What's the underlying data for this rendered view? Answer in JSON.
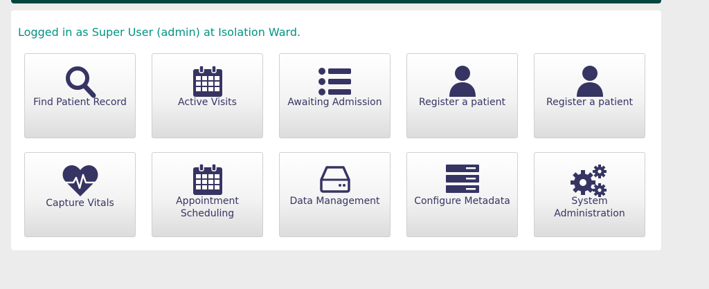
{
  "header": {
    "welcome": "Logged in as Super User (admin) at Isolation Ward."
  },
  "apps": [
    {
      "label": "Find Patient Record",
      "icon": "search-icon"
    },
    {
      "label": "Active Visits",
      "icon": "calendar-icon"
    },
    {
      "label": "Awaiting Admission",
      "icon": "list-icon"
    },
    {
      "label": "Register a patient",
      "icon": "user-icon"
    },
    {
      "label": "Register a patient",
      "icon": "user-icon"
    },
    {
      "label": "Capture Vitals",
      "icon": "heart-pulse-icon"
    },
    {
      "label": "Appointment Scheduling",
      "icon": "calendar-icon"
    },
    {
      "label": "Data Management",
      "icon": "hard-drive-icon"
    },
    {
      "label": "Configure Metadata",
      "icon": "server-icon"
    },
    {
      "label": "System Administration",
      "icon": "gears-icon"
    }
  ],
  "colors": {
    "accent": "#009384",
    "icon": "#363463",
    "topbar": "#00463f"
  }
}
